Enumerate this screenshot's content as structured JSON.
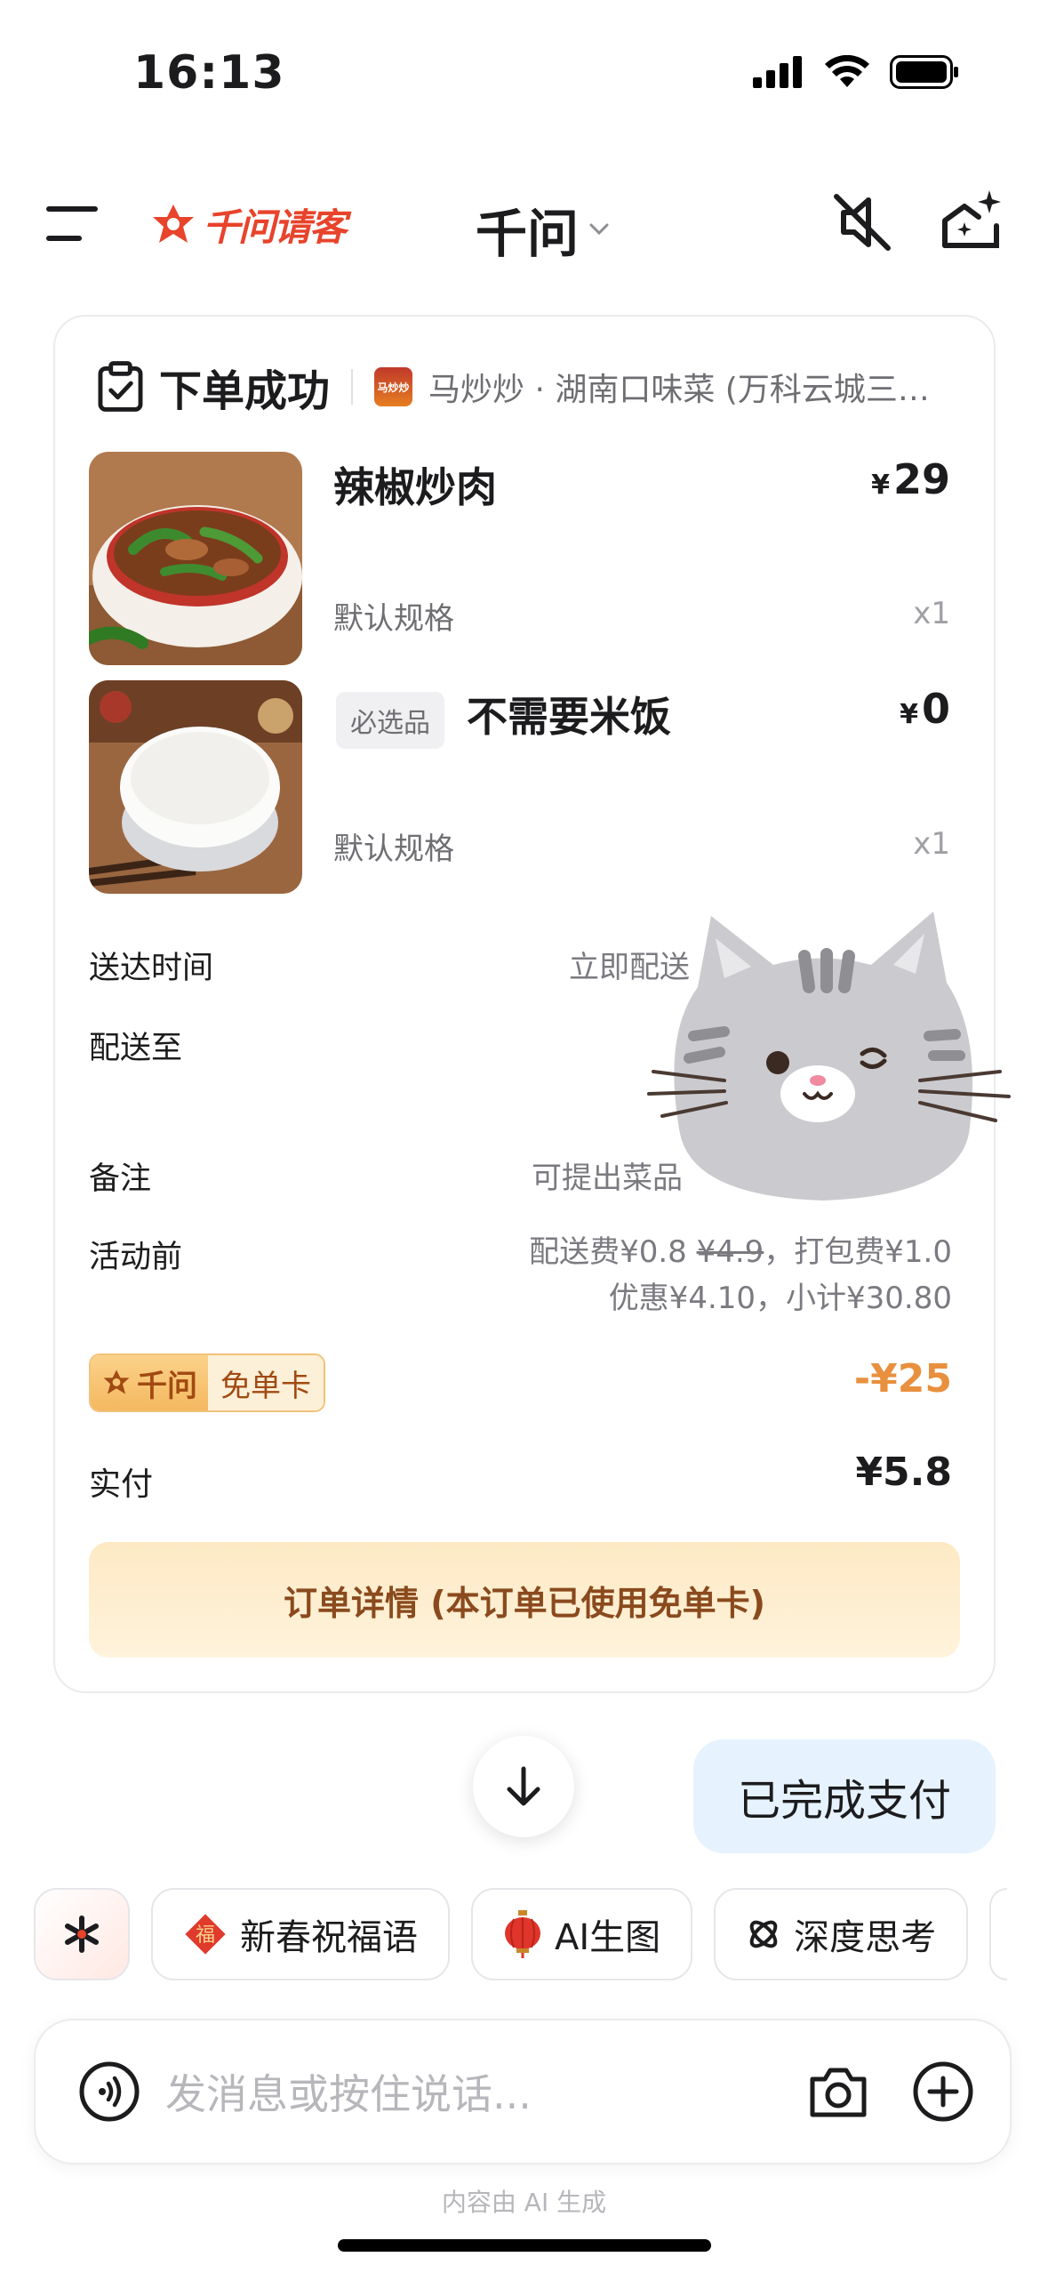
{
  "status_bar": {
    "time": "16:13"
  },
  "header": {
    "brand": "千问请客",
    "title": "千问"
  },
  "order": {
    "status": "下单成功",
    "shop_name": "马炒炒 · 湖南口味菜 (万科云城三期…",
    "shop_logo_text": "马炒炒",
    "items": [
      {
        "name": "辣椒炒肉",
        "currency": "¥",
        "price": "29",
        "spec": "默认规格",
        "qty": "x1",
        "tag": ""
      },
      {
        "name": "不需要米饭",
        "currency": "¥",
        "price": "0",
        "spec": "默认规格",
        "qty": "x1",
        "tag": "必选品"
      }
    ],
    "rows": {
      "delivery_time_label": "送达时间",
      "delivery_time_value": "立即配送",
      "delivery_to_label": "配送至",
      "note_label": "备注",
      "note_value": "可提出菜品",
      "activity_label": "活动前",
      "activity_line1_a": "配送费¥0.8 ",
      "activity_line1_strike": "¥4.9",
      "activity_line1_b": "，打包费¥1.0",
      "activity_line2": "优惠¥4.10，小计¥30.80"
    },
    "coupon": {
      "brand": "千问",
      "label": "免单卡",
      "discount": "-¥25"
    },
    "paid_label": "实付",
    "paid_value": "¥5.8",
    "detail_button": "订单详情 (本订单已使用免单卡)"
  },
  "chat": {
    "user_bubble": "已完成支付"
  },
  "chips": [
    {
      "label": "新春祝福语",
      "icon": "fu-icon"
    },
    {
      "label": "AI生图",
      "icon": "lantern-icon"
    },
    {
      "label": "深度思考",
      "icon": "think-icon"
    }
  ],
  "input": {
    "placeholder": "发消息或按住说话..."
  },
  "footer": {
    "ai_note": "内容由 AI 生成"
  },
  "colors": {
    "brand_red": "#e8432b",
    "discount_orange": "#e8903e",
    "bubble_blue": "#e6f2fd"
  }
}
